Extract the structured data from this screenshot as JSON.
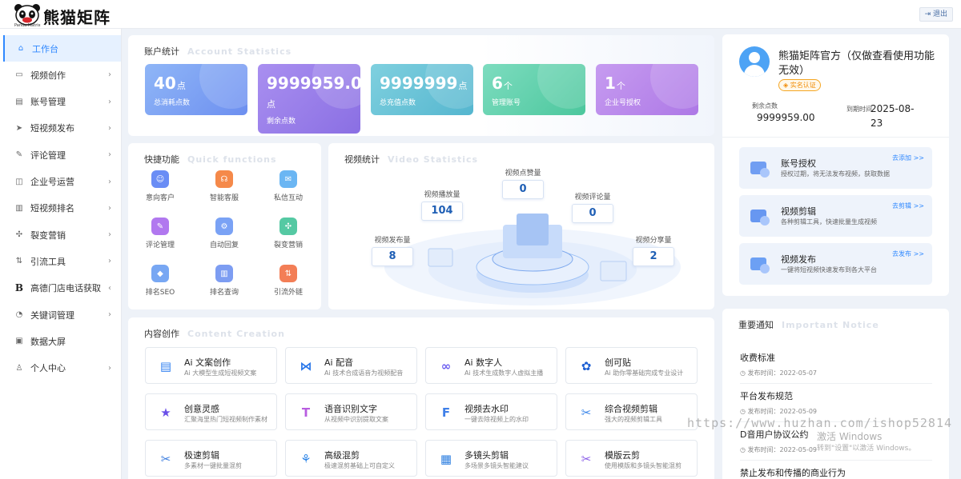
{
  "header": {
    "brand": "熊猫矩阵",
    "brand_sub": "Panda Matrix",
    "logout": "退出"
  },
  "sidebar": {
    "items": [
      {
        "label": "工作台",
        "icon": "home-icon",
        "glyph": "⌂",
        "active": true,
        "arrow": ""
      },
      {
        "label": "视频创作",
        "icon": "video-icon",
        "glyph": "▭",
        "arrow": "›"
      },
      {
        "label": "账号管理",
        "icon": "id-card-icon",
        "glyph": "▤",
        "arrow": "›"
      },
      {
        "label": "短视频发布",
        "icon": "send-icon",
        "glyph": "➤",
        "arrow": "›"
      },
      {
        "label": "评论管理",
        "icon": "comment-icon",
        "glyph": "✎",
        "arrow": "›"
      },
      {
        "label": "企业号运营",
        "icon": "enterprise-icon",
        "glyph": "◫",
        "arrow": "›"
      },
      {
        "label": "短视频排名",
        "icon": "bar-chart-icon",
        "glyph": "▥",
        "arrow": "›"
      },
      {
        "label": "裂变营销",
        "icon": "fission-icon",
        "glyph": "✣",
        "arrow": "›"
      },
      {
        "label": "引流工具",
        "icon": "traffic-icon",
        "glyph": "⇅",
        "arrow": "›"
      },
      {
        "label": "高德门店电话获取",
        "icon": "b-icon",
        "glyph": "B",
        "arrow": "‹"
      },
      {
        "label": "关键词管理",
        "icon": "keyword-icon",
        "glyph": "◔",
        "arrow": "›"
      },
      {
        "label": "数据大屏",
        "icon": "screen-icon",
        "glyph": "▣",
        "arrow": ""
      },
      {
        "label": "个人中心",
        "icon": "user-icon",
        "glyph": "♙",
        "arrow": "›"
      }
    ]
  },
  "account_stats": {
    "title": "账户统计",
    "title_en": "Account Statistics",
    "cards": [
      {
        "value": "40",
        "unit": "点",
        "label": "总消耗点数",
        "color1": "#8fb6f7",
        "color2": "#6d8ff0"
      },
      {
        "value": "9999959.00",
        "unit": "点",
        "label": "剩余点数",
        "color1": "#a98ff0",
        "color2": "#8a6fe3"
      },
      {
        "value": "9999999",
        "unit": "点",
        "label": "总充值点数",
        "color1": "#7fd0df",
        "color2": "#55b6cf"
      },
      {
        "value": "6",
        "unit": "个",
        "label": "管理账号",
        "color1": "#7ddcbf",
        "color2": "#4cc79d"
      },
      {
        "value": "1",
        "unit": "个",
        "label": "企业号授权",
        "color1": "#c69bf0",
        "color2": "#ad78e6"
      }
    ]
  },
  "quick": {
    "title": "快捷功能",
    "title_en": "Quick functions",
    "items": [
      {
        "label": "意向客户",
        "icon": "intent-customer-icon",
        "color": "#6a8df5",
        "glyph": "☺"
      },
      {
        "label": "智能客服",
        "icon": "service-icon",
        "color": "#f5894a",
        "glyph": "☊"
      },
      {
        "label": "私信互动",
        "icon": "message-icon",
        "color": "#6bb6f3",
        "glyph": "✉"
      },
      {
        "label": "评论管理",
        "icon": "comment-manage-icon",
        "color": "#b178ef",
        "glyph": "✎"
      },
      {
        "label": "自动回复",
        "icon": "robot-icon",
        "color": "#7aa2f5",
        "glyph": "⚙"
      },
      {
        "label": "裂变营销",
        "icon": "fission-marketing-icon",
        "color": "#55c9a3",
        "glyph": "✣"
      },
      {
        "label": "排名SEO",
        "icon": "seo-icon",
        "color": "#78a7f3",
        "glyph": "◆"
      },
      {
        "label": "排名查询",
        "icon": "rank-query-icon",
        "color": "#7d9df2",
        "glyph": "▥"
      },
      {
        "label": "引流外链",
        "icon": "link-icon",
        "color": "#f37e56",
        "glyph": "⇅"
      }
    ]
  },
  "video_stats": {
    "title": "视频统计",
    "title_en": "Video Statistics",
    "items": [
      {
        "label": "视频点赞量",
        "value": "0"
      },
      {
        "label": "视频播放量",
        "value": "104"
      },
      {
        "label": "视频评论量",
        "value": "0"
      },
      {
        "label": "视频发布量",
        "value": "8"
      },
      {
        "label": "视频分享量",
        "value": "2"
      }
    ]
  },
  "content": {
    "title": "内容创作",
    "title_en": "Content Creation",
    "items": [
      {
        "title": "Ai 文案创作",
        "desc": "Ai 大模型生成短视频文案",
        "icon": "ai-copy-icon",
        "color": "#2f7ff0",
        "glyph": "▤"
      },
      {
        "title": "Ai 配音",
        "desc": "Ai 技术合成语音为视频配音",
        "icon": "ai-dub-icon",
        "color": "#2a78ea",
        "glyph": "⋈"
      },
      {
        "title": "Ai 数字人",
        "desc": "Ai 技术生成数字人虚拟主播",
        "icon": "ai-human-icon",
        "color": "#6a5cf0",
        "glyph": "∞"
      },
      {
        "title": "创可贴",
        "desc": "Ai 助你零基础完成专业设计",
        "icon": "chuangketie-icon",
        "color": "#1d5fd3",
        "glyph": "✿"
      },
      {
        "title": "创意灵感",
        "desc": "汇聚海里热门短视频制作素材",
        "icon": "star-icon",
        "color": "#6a4fe8",
        "glyph": "★"
      },
      {
        "title": "语音识别文字",
        "desc": "从视频中识别提取文案",
        "icon": "speech-icon",
        "color": "#b85de0",
        "glyph": "T"
      },
      {
        "title": "视频去水印",
        "desc": "一键去除视频上的水印",
        "icon": "remove-watermark-icon",
        "color": "#3f7fe8",
        "glyph": "F"
      },
      {
        "title": "综合视频剪辑",
        "desc": "强大的视频剪辑工具",
        "icon": "compose-edit-icon",
        "color": "#3a86ea",
        "glyph": "✂"
      },
      {
        "title": "极速剪辑",
        "desc": "多素材一键批量混剪",
        "icon": "scissors-icon",
        "color": "#3b7ddf",
        "glyph": "✂"
      },
      {
        "title": "高级混剪",
        "desc": "极速混剪基础上可自定义",
        "icon": "advanced-mix-icon",
        "color": "#2f86e8",
        "glyph": "⚘"
      },
      {
        "title": "多镜头剪辑",
        "desc": "多场景多镜头智能建议",
        "icon": "clapper-icon",
        "color": "#2e7fe0",
        "glyph": "▦"
      },
      {
        "title": "模版云剪",
        "desc": "使用模版和多镜头智能混剪",
        "icon": "template-cloud-icon",
        "color": "#8a5ee8",
        "glyph": "✂"
      }
    ]
  },
  "profile": {
    "name": "熊猫矩阵官方（仅做查看使用功能无效）",
    "badge": "实名认证",
    "points_label": "剩余点数",
    "points": "9999959.00",
    "expire_label": "到期时间",
    "expire": "2025-08-23"
  },
  "features": [
    {
      "title": "账号授权",
      "desc": "授权过期，将无法发布视频，获取数据",
      "action": "去添加 >>",
      "icon": "account-auth-icon"
    },
    {
      "title": "视频剪辑",
      "desc": "各种剪辑工具，快速批量生成视频",
      "action": "去剪辑 >>",
      "icon": "video-edit-icon"
    },
    {
      "title": "视频发布",
      "desc": "一键将短视频快速发布到各大平台",
      "action": "去发布 >>",
      "icon": "video-publish-icon"
    }
  ],
  "notices": {
    "title": "重要通知",
    "title_en": "Important Notice",
    "items": [
      {
        "title": "收费标准",
        "date": "发布时间：2022-05-07"
      },
      {
        "title": "平台发布规范",
        "date": "发布时间：2022-05-09"
      },
      {
        "title": "D音用户协议公约",
        "date": "发布时间：2022-05-09"
      },
      {
        "title": "禁止发布和传播的商业行为",
        "date": ""
      }
    ]
  },
  "overlay": {
    "watermark": "https://www.huzhan.com/ishop52814",
    "activate_title": "激活 Windows",
    "activate_sub": "转到\"设置\"以激活 Windows。"
  }
}
